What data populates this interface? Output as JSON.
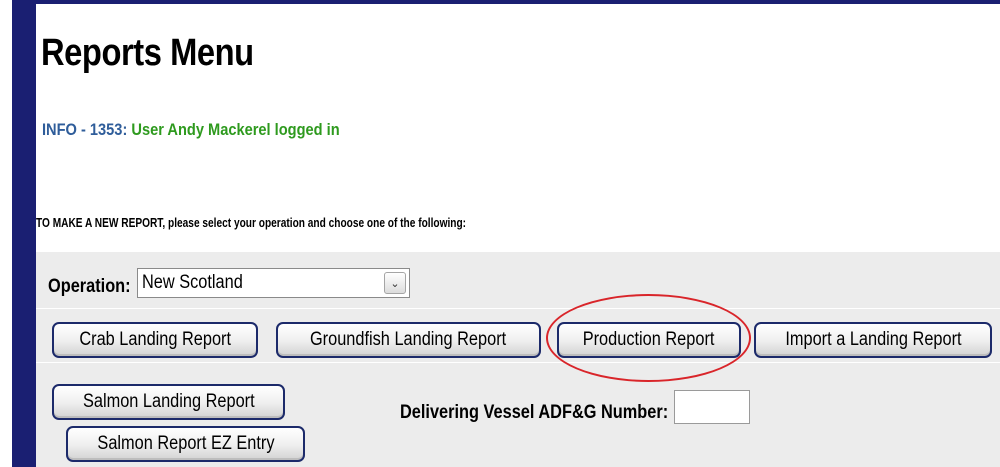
{
  "page": {
    "title": "Reports Menu",
    "info_code": "INFO - 1353:",
    "info_message": "User Andy Mackerel logged in",
    "instructions": "TO MAKE A NEW REPORT, please select your operation and choose one of the following:"
  },
  "operation": {
    "label": "Operation:",
    "selected": "New Scotland",
    "dropdown_icon": "chevron-down-icon"
  },
  "buttons": {
    "crab": "Crab Landing Report",
    "groundfish": "Groundfish Landing Report",
    "production": "Production Report",
    "import": "Import a Landing Report",
    "salmon": "Salmon Landing Report",
    "salmon_ez": "Salmon Report EZ Entry"
  },
  "vessel": {
    "label": "Delivering Vessel ADF&G Number:",
    "value": ""
  },
  "colors": {
    "side_stripe": "#1a1f72",
    "info_code": "#2f5d9a",
    "info_message": "#2e9a1e",
    "highlight": "#d9252a"
  }
}
